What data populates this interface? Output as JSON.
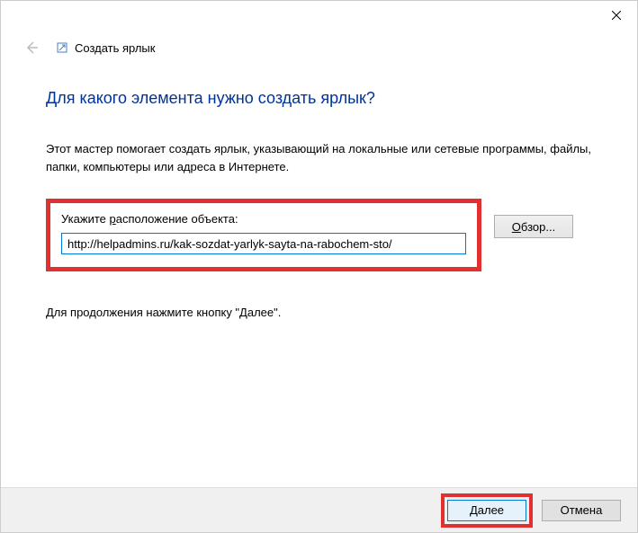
{
  "titlebar": {
    "wizard_name": "Создать ярлык"
  },
  "content": {
    "heading": "Для какого элемента нужно создать ярлык?",
    "description": "Этот мастер помогает создать ярлык, указывающий на локальные или сетевые программы, файлы, папки, компьютеры или адреса в Интернете.",
    "location_label_pre": "Укажите ",
    "location_label_u": "р",
    "location_label_post": "асположение объекта:",
    "location_value": "http://helpadmins.ru/kak-sozdat-yarlyk-sayta-na-rabochem-sto/",
    "browse_u": "О",
    "browse_post": "бзор...",
    "continue_text": "Для продолжения нажмите кнопку \"Далее\"."
  },
  "footer": {
    "next_u": "Д",
    "next_post": "алее",
    "cancel": "Отмена"
  }
}
